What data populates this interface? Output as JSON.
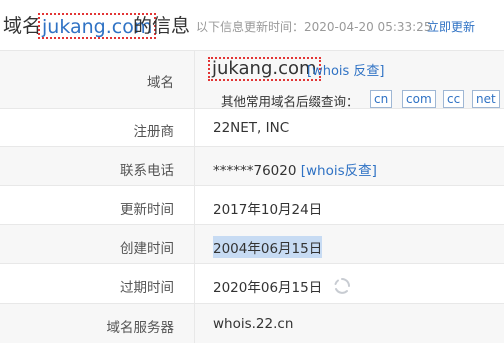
{
  "header": {
    "prefix": "域名",
    "domain": "jukang.com",
    "suffix": "的信息",
    "meta": "以下信息更新时间：2020-04-20 05:33:25",
    "update_link": "立即更新"
  },
  "rows": [
    {
      "label": "域名",
      "value": "jukang.com",
      "link": "[whois 反查]"
    },
    {
      "label": "注册商",
      "value": "22NET, INC"
    },
    {
      "label": "联系电话",
      "value": "******76020",
      "link": "[whois反查]"
    },
    {
      "label": "更新时间",
      "value": "2017年10月24日"
    },
    {
      "label": "创建时间",
      "value": "2004年06月15日"
    },
    {
      "label": "过期时间",
      "value": "2020年06月15日"
    },
    {
      "label": "域名服务器",
      "value": "whois.22.cn"
    }
  ],
  "suffix_query": {
    "label": "其他常用域名后缀查询：",
    "tags": [
      "cn",
      "com",
      "cc",
      "net"
    ]
  },
  "colors": {
    "link": "#2f72c4",
    "highlight_border": "#e23535",
    "selection": "#c7dbf3"
  }
}
